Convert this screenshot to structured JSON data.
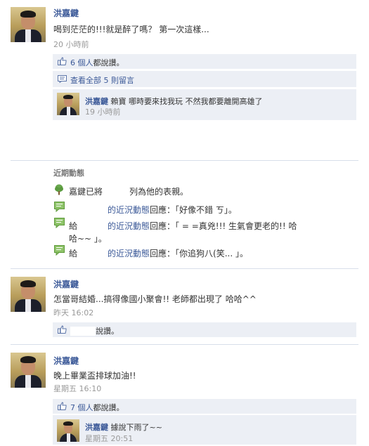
{
  "post1": {
    "author": "洪嘉鍵",
    "text": "喝到茫茫的!!!就是醉了嗎？ 第一次這樣...",
    "time": "20 小時前",
    "likes": "6 個人",
    "likes_suffix": "都說讚。",
    "view_all": "查看全部 5 則留言",
    "comment": {
      "author": "洪嘉鍵",
      "text": "賴寶 哪時要來找我玩 不然我都要離開高雄了",
      "time": "19 小時前"
    }
  },
  "activity": {
    "heading": "近期動態",
    "items": [
      {
        "icon": "tree-icon",
        "prefix": "嘉鍵已將",
        "link": "",
        "suffix": "列為他的表親。"
      },
      {
        "icon": "comment-icon",
        "prefix": "",
        "link": "的近況動態",
        "suffix": "回應：「好像不錯 ㄎ」。"
      },
      {
        "icon": "comment-icon",
        "prefix": "給",
        "link": "的近況動態",
        "suffix": "回應：「 = =真兇!!! 生氣會更老的!! 哈",
        "suffix2": "哈~~ 」。"
      },
      {
        "icon": "comment-icon",
        "prefix": "給",
        "link": "的近況動態",
        "suffix": "回應：「你追狗八(笑... 」。"
      }
    ]
  },
  "post2": {
    "author": "洪嘉鍵",
    "text": "怎當哥結婚...搞得像國小聚會!! 老師都出現了 哈哈^^",
    "time": "昨天 16:02",
    "likes_suffix": "說讚。"
  },
  "post3": {
    "author": "洪嘉鍵",
    "text": "晚上畢業盃排球加油!!",
    "time": "星期五 16:10",
    "likes": "7 個人",
    "likes_suffix": "都說讚。",
    "comment": {
      "author": "洪嘉鍵",
      "text": "據說下雨了~~",
      "time": "星期五 20:51"
    }
  },
  "colors": {
    "link": "#3b5998",
    "box": "#eceff5",
    "separator": "#d8dfea"
  }
}
